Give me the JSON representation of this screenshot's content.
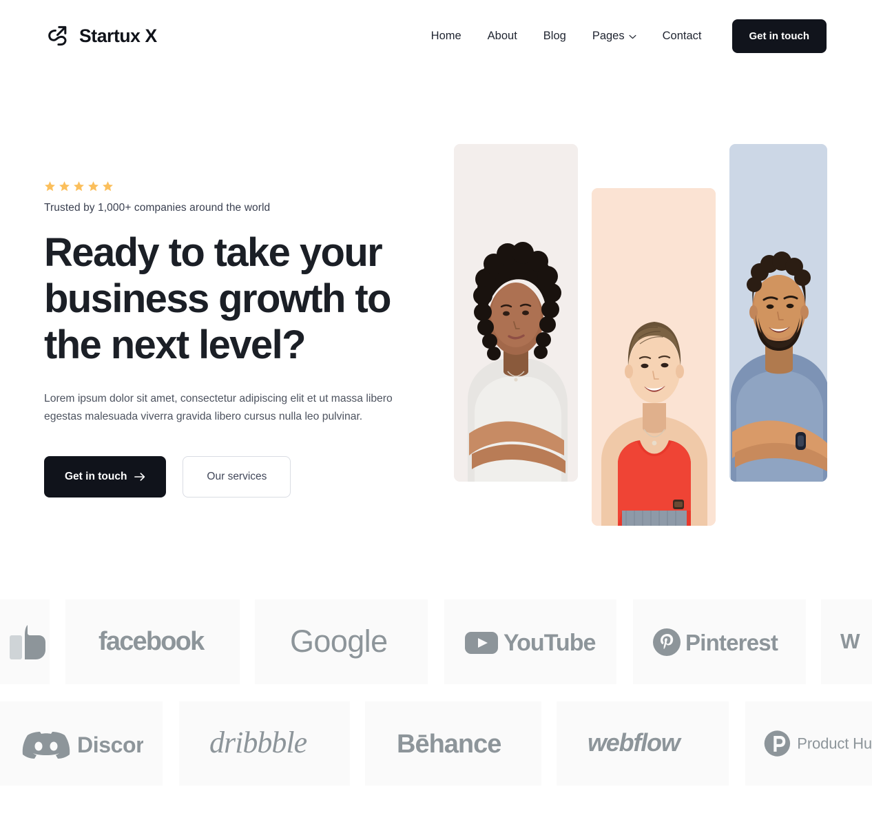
{
  "header": {
    "brand": {
      "name": "Startux X",
      "logo_icon": "arrow-swoosh-logo-icon"
    },
    "nav": [
      {
        "label": "Home",
        "icon": null
      },
      {
        "label": "About",
        "icon": null
      },
      {
        "label": "Blog",
        "icon": null
      },
      {
        "label": "Pages",
        "icon": "chevron-down-icon"
      },
      {
        "label": "Contact",
        "icon": null
      }
    ],
    "cta_label": "Get in touch"
  },
  "hero": {
    "rating_stars": 5,
    "star_color": "#fbbf5c",
    "trusted_text": "Trusted by 1,000+ companies around the world",
    "headline": "Ready to take your business growth to the next level?",
    "subcopy": "Lorem ipsum dolor sit amet, consectetur adipiscing elit et ut massa libero egestas malesuada viverra gravida libero cursus nulla leo pulvinar.",
    "primary_cta": {
      "label": "Get in touch",
      "icon": "arrow-right-icon"
    },
    "secondary_cta": {
      "label": "Our services"
    },
    "photos": [
      {
        "name": "portrait-woman-curly-hair",
        "bg": "#f3eeec"
      },
      {
        "name": "portrait-woman-red-top",
        "bg": "#fbe3d3"
      },
      {
        "name": "portrait-man-blue-shirt",
        "bg": "#ccd7e6"
      }
    ]
  },
  "logos": {
    "color": "#8d959a",
    "card_bg": "#fafafa",
    "row1": [
      {
        "name": "thumbs-up",
        "label": "",
        "partial": "left"
      },
      {
        "name": "facebook",
        "label": "facebook",
        "partial": null
      },
      {
        "name": "google",
        "label": "Google",
        "partial": null
      },
      {
        "name": "youtube",
        "label": "YouTube",
        "partial": null
      },
      {
        "name": "pinterest",
        "label": "Pinterest",
        "partial": null
      },
      {
        "name": "wordpress",
        "label": "W",
        "partial": "right"
      }
    ],
    "row2": [
      {
        "name": "discord",
        "label": "Discord",
        "partial": null
      },
      {
        "name": "dribbble",
        "label": "dribbble",
        "partial": null
      },
      {
        "name": "behance",
        "label": "Bēhance",
        "partial": null
      },
      {
        "name": "webflow",
        "label": "webflow",
        "partial": null
      },
      {
        "name": "producthunt",
        "label": "Product Hu",
        "partial": "right"
      }
    ]
  }
}
